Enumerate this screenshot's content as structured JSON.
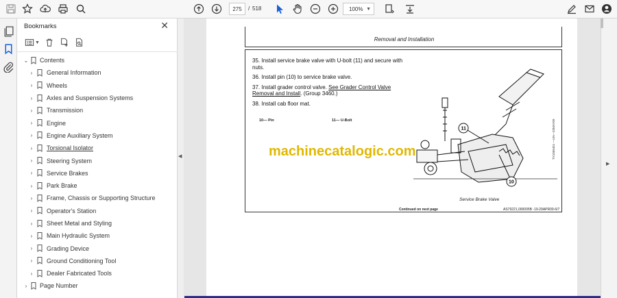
{
  "toolbar": {
    "page_current": "275",
    "page_separator": "/",
    "page_total": "518",
    "zoom_value": "100%"
  },
  "panel": {
    "title": "Bookmarks",
    "close_glyph": "✕"
  },
  "bookmarks": [
    {
      "label": "Contents",
      "level": 0,
      "expanded": true
    },
    {
      "label": "General Information",
      "level": 1
    },
    {
      "label": "Wheels",
      "level": 1
    },
    {
      "label": "Axles and Suspension Systems",
      "level": 1
    },
    {
      "label": "Transmission",
      "level": 1
    },
    {
      "label": "Engine",
      "level": 1
    },
    {
      "label": "Engine Auxiliary System",
      "level": 1
    },
    {
      "label": "Torsional Isolator",
      "level": 1,
      "underline": true
    },
    {
      "label": "Steering System",
      "level": 1
    },
    {
      "label": "Service Brakes",
      "level": 1
    },
    {
      "label": "Park Brake",
      "level": 1
    },
    {
      "label": "Frame, Chassis or Supporting Structure",
      "level": 1
    },
    {
      "label": "Operator's Station",
      "level": 1
    },
    {
      "label": "Sheet Metal and Styling",
      "level": 1
    },
    {
      "label": "Main Hydraulic System",
      "level": 1
    },
    {
      "label": "Grading Device",
      "level": 1
    },
    {
      "label": "Ground Conditioning Tool",
      "level": 1
    },
    {
      "label": "Dealer Fabricated Tools",
      "level": 1
    },
    {
      "label": "Page Number",
      "level": 0,
      "expanded": false
    }
  ],
  "document": {
    "header_title": "Removal and Installation",
    "steps": [
      {
        "text": "35. Install service brake valve with U-bolt (11) and secure with nuts."
      },
      {
        "text": "36. Install pin (10) to service brake valve."
      },
      {
        "text_before": "37. Install grader control valve. ",
        "link": "See Grader Control Valve Removal and Install",
        "text_after": ". (Group 3460.)"
      },
      {
        "text": "38. Install cab floor mat."
      }
    ],
    "legend_10": "10— Pin",
    "legend_11": "11— U-Bolt",
    "callout_10": "10",
    "callout_11": "11",
    "figure_caption": "Service Brake Valve",
    "figure_code": "TX1056451 —UN—23MAY09",
    "footer_left": "Continued on next page",
    "footer_right": "AS79221,000005B -19-29APR09-6/7",
    "watermark": "machinecatalogic.com"
  },
  "colors": {
    "accent": "#1a5fd6",
    "watermark": "#e0b800"
  }
}
